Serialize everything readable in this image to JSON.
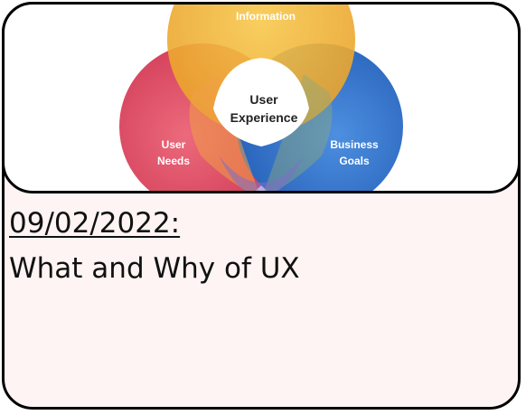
{
  "card": {
    "date": "09/02/2022:",
    "title": "What and Why of UX"
  },
  "diagram": {
    "top_label": "Information",
    "left_label_line1": "User",
    "left_label_line2": "Needs",
    "right_label_line1": "Business",
    "right_label_line2": "Goals",
    "center_line1": "User",
    "center_line2": "Experience",
    "colors": {
      "top": "#f2b233",
      "left": "#e04a63",
      "right": "#2f6fc4"
    }
  }
}
